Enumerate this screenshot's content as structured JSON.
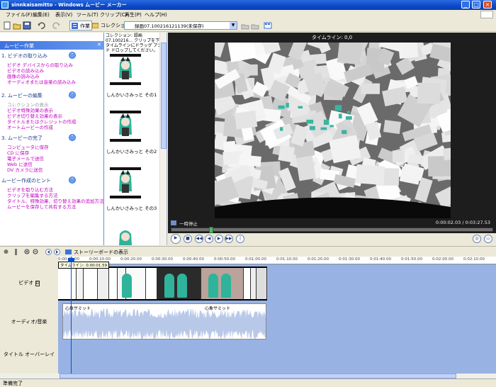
{
  "window": {
    "title": "sinnkaisamitto - Windows ムービー メーカー"
  },
  "menu": [
    "ファイル(F)",
    "編集(E)",
    "表示(V)",
    "ツール(T)",
    "クリップ(C)",
    "再生(P)",
    "ヘルプ(H)"
  ],
  "toolbar": {
    "tasks_label": "作業",
    "collections_label": "コレクション",
    "collection_value": "録画07.100216121139(未保存)"
  },
  "taskpane": {
    "header": "ムービー作業",
    "sections": [
      {
        "title": "1. ビデオの取り込み",
        "links": [
          "ビデオ デバイスからの取り込み",
          "ビデオの読み込み",
          "画像の読み込み",
          "オーディオまたは音楽の読み込み"
        ],
        "dim": []
      },
      {
        "title": "2. ムービーの編集",
        "links": [
          "コレクションの表示",
          "ビデオ特殊効果の表示",
          "ビデオ切り替え効果の表示",
          "タイトルまたはクレジットの作成",
          "オートムービーの作成"
        ],
        "dim": [
          0
        ]
      },
      {
        "title": "3. ムービーの完了",
        "links": [
          "コンピュータに保存",
          "CD に保存",
          "電子メールで送信",
          "Web に送信",
          "DV カメラに送信"
        ],
        "dim": []
      },
      {
        "title": "ムービー作成のヒント",
        "links": [
          "ビデオを取り込む方法",
          "クリップを編集する方法",
          "タイトル、特殊効果、切り替え効果の追加方法",
          "ムービーを保存して共有する方法"
        ],
        "dim": []
      }
    ]
  },
  "clips": {
    "description": "コレクション: 録画07.100216... クリップを下のタイムラインにドラッグ アンド ドロップしてください。",
    "items": [
      {
        "label": "しんかいさみっと その1"
      },
      {
        "label": "しんかいさみっと その2"
      },
      {
        "label": "しんかいさみっと その3"
      }
    ]
  },
  "monitor": {
    "title": "タイムライン: 0,0",
    "status": "一時停止",
    "time": "0:00:02.03 / 0:03:27.53",
    "playback_fraction": 0.012
  },
  "timeline": {
    "storyboard_label": "ストーリーボードの表示",
    "ruler": [
      "0:00:00.00",
      "0:00:10.00",
      "0:00:20.00",
      "0:00:30.00",
      "0:00:40.00",
      "0:00:50.00",
      "0:01:00.00",
      "0:01:10.00",
      "0:01:20.00",
      "0:01:30.00",
      "0:01:40.00",
      "0:01:50.00",
      "0:02:00.00",
      "0:02:10.00"
    ],
    "tracks": {
      "video": "ビデオ",
      "audio": "オーディオ/音楽",
      "title": "タイトル オーバーレイ"
    },
    "audio_clips": [
      "心象サミット",
      "心象サミット"
    ],
    "tooltip": "タイムライン: 0:00:01.59"
  },
  "status": "準備完了"
}
